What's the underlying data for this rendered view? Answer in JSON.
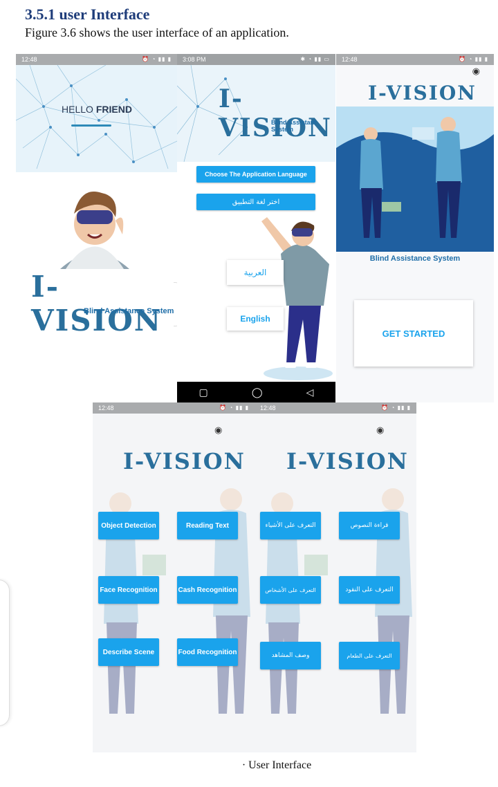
{
  "document": {
    "heading": "3.5.1 user Interface",
    "intro": "Figure 3.6 shows the user interface of an application.",
    "caption": "· User Interface"
  },
  "screen1": {
    "status_time": "12:48",
    "greeting_hello": "HELLO",
    "greeting_friend": "FRIEND",
    "logo": "I-VISION",
    "logo_sub": "Blind Assistance System"
  },
  "screen2": {
    "status_time": "3:08 PM",
    "logo": "I-VISION",
    "logo_sub": "Blind Assistant System",
    "choose_language_en": "Choose The Application Language",
    "choose_language_ar": "اختر لغة التطبيق",
    "arabic_option": "العربية",
    "english_option": "English",
    "nav_icons": [
      "square-icon",
      "circle-icon",
      "triangle-back-icon"
    ]
  },
  "screen3": {
    "status_time": "12:48",
    "logo": "I-VISION",
    "tagline": "Blind Assistance System",
    "get_started": "GET STARTED"
  },
  "screen4": {
    "status_time": "12:48",
    "logo": "I-VISION",
    "buttons": [
      "Object Detection",
      "Reading Text",
      "Face Recognition",
      "Cash Recognition",
      "Describe Scene",
      "Food Recognition"
    ]
  },
  "screen5": {
    "status_time": "12:48",
    "logo": "I-VISION",
    "buttons": [
      "التعرف على الأشياء",
      "قراءة النصوص",
      "التعرف على الأشخاص",
      "التعرف على النقود",
      "وصف المشاهد",
      "التعرف على الطعام"
    ]
  },
  "colors": {
    "accent": "#1aa3ec",
    "heading": "#1f3d7a",
    "illustration_blue": "#1f5fa0"
  }
}
